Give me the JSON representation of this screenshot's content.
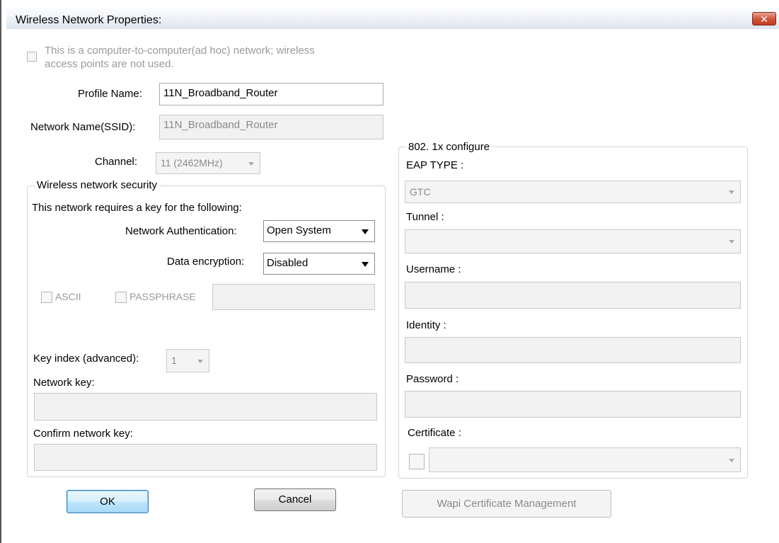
{
  "window": {
    "title": "Wireless Network Properties:",
    "close_glyph": "✕"
  },
  "adhoc": {
    "line1": "This is a computer-to-computer(ad hoc) network; wireless",
    "line2": "access points are not used.",
    "checked": false
  },
  "profile": {
    "label": "Profile Name:",
    "value": "11N_Broadband_Router"
  },
  "ssid": {
    "label": "Network Name(SSID):",
    "value": "11N_Broadband_Router"
  },
  "channel": {
    "label": "Channel:",
    "value": "11 (2462MHz)"
  },
  "security": {
    "legend": "Wireless network security",
    "requires_text": "This network requires a key for the following:",
    "auth_label": "Network Authentication:",
    "auth_value": "Open System",
    "enc_label": "Data encryption:",
    "enc_value": "Disabled",
    "ascii_label": "ASCII",
    "passphrase_label": "PASSPHRASE",
    "passphrase_value": "",
    "key_index_label": "Key index (advanced):",
    "key_index_value": "1",
    "network_key_label": "Network key:",
    "network_key_value": "",
    "confirm_key_label": "Confirm network key:",
    "confirm_key_value": ""
  },
  "dot1x": {
    "legend": "802. 1x configure",
    "eap_label": "EAP TYPE :",
    "eap_value": "GTC",
    "tunnel_label": "Tunnel :",
    "tunnel_value": "",
    "username_label": "Username :",
    "username_value": "",
    "identity_label": "Identity :",
    "identity_value": "",
    "password_label": "Password :",
    "password_value": "",
    "certificate_label": "Certificate :",
    "certificate_value": ""
  },
  "buttons": {
    "ok": "OK",
    "cancel": "Cancel",
    "wapi": "Wapi Certificate Management"
  },
  "colors": {
    "disabled_text": "#9a9a9a",
    "default_button_border": "#3c7fb1",
    "close_button": "#c13d22"
  }
}
